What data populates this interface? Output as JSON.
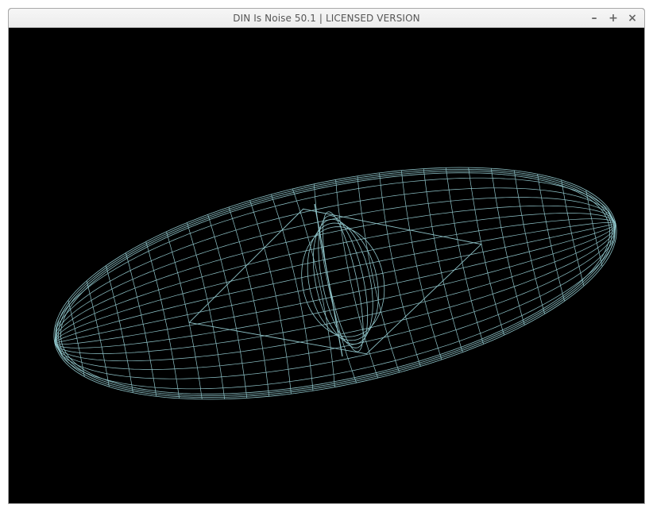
{
  "window": {
    "title": "DIN Is Noise 50.1 | LICENSED VERSION",
    "controls": {
      "minimize": "–",
      "maximize": "+",
      "close": "×"
    }
  },
  "canvas": {
    "background": "#000000",
    "wire_color": "#8fc4c9"
  }
}
